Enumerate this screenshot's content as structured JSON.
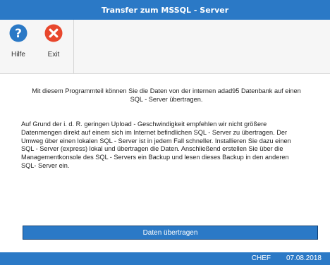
{
  "window": {
    "title": "Transfer zum MSSQL - Server"
  },
  "ribbon": {
    "help": {
      "label": "Hilfe",
      "icon": "help-icon",
      "color": "#2b79c6"
    },
    "exit": {
      "label": "Exit",
      "icon": "close-icon",
      "color": "#e8472d"
    }
  },
  "content": {
    "intro_line1": "Mit diesem Programmteil können Sie die Daten von der internen adad95 Datenbank auf einen",
    "intro_line2": "SQL  - Server übertragen.",
    "body_line1": "Auf Grund der i. d. R. geringen Upload  - Geschwindigkeit empfehlen wir nicht größere",
    "body_line2": "Datenmengen direkt auf einem sich im Internet befindlichen SQL  - Server zu übertragen. Der",
    "body_line3": "Umweg über einen lokalen SQL  - Server ist in jedem Fall schneller. Installieren Sie dazu einen",
    "body_line4": "SQL - Server (express) lokal und übertragen die Daten. Anschließend  erstellen Sie über die",
    "body_line5": "Managementkonsole des SQL - Servers ein Backup und lesen dieses Backup in den anderen",
    "body_line6": "SQL- Server ein.",
    "transfer_button": "Daten übertragen"
  },
  "status": {
    "user": "CHEF",
    "date": "07.08.2018"
  },
  "colors": {
    "accent": "#2b79c6",
    "exit": "#e8472d"
  }
}
